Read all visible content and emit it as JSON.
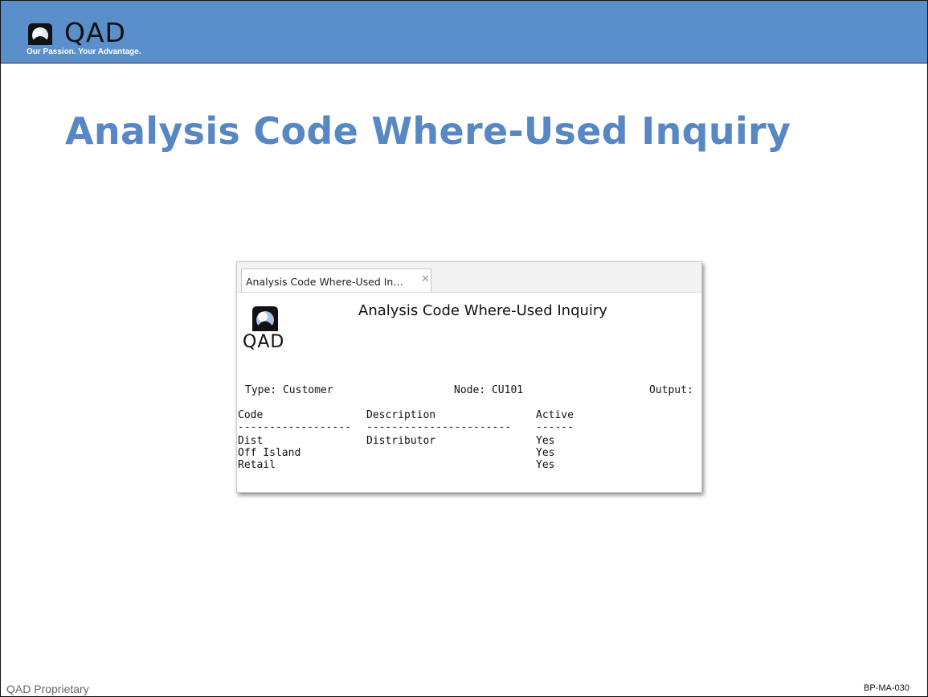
{
  "header": {
    "logo_text": "QAD",
    "tagline": "Our Passion. Your Advantage.",
    "bar_color": "#5b8fcb"
  },
  "slide": {
    "title": "Analysis Code Where-Used Inquiry",
    "title_color": "#5787c4"
  },
  "window": {
    "tab_label": "Analysis Code Where-Used In…",
    "tab_close": "✕",
    "logo_text": "QAD",
    "report_title": "Analysis Code Where-Used Inquiry",
    "type_line": "Type: Customer",
    "node_line": "Node: CU101",
    "output_line": "Output:",
    "columns": {
      "code": "Code",
      "description": "Description",
      "active": "Active"
    },
    "separators": {
      "code": "------------------",
      "description": "-----------------------",
      "active": "------"
    },
    "rows": [
      {
        "code": "Dist",
        "description": "Distributor",
        "active": "Yes"
      },
      {
        "code": "Off Island",
        "description": "",
        "active": "Yes"
      },
      {
        "code": "Retail",
        "description": "",
        "active": "Yes"
      }
    ]
  },
  "footer": {
    "left": "QAD Proprietary",
    "right": "BP-MA-030"
  }
}
